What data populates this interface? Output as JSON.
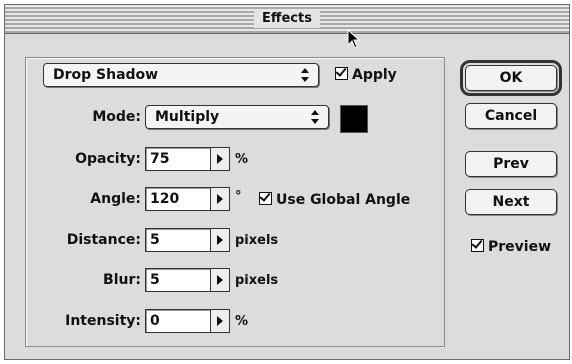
{
  "window": {
    "title": "Effects"
  },
  "effect_select": {
    "value": "Drop Shadow"
  },
  "apply": {
    "label": "Apply",
    "checked": true
  },
  "mode": {
    "label": "Mode:",
    "value": "Multiply"
  },
  "shadow_color": {
    "color": "#000000"
  },
  "opacity": {
    "label": "Opacity:",
    "value": "75",
    "unit": "%"
  },
  "angle": {
    "label": "Angle:",
    "value": "120",
    "unit": "°"
  },
  "global_angle": {
    "label": "Use Global Angle",
    "checked": true
  },
  "distance": {
    "label": "Distance:",
    "value": "5",
    "unit": "pixels"
  },
  "blur": {
    "label": "Blur:",
    "value": "5",
    "unit": "pixels"
  },
  "intensity": {
    "label": "Intensity:",
    "value": "0",
    "unit": "%"
  },
  "buttons": {
    "ok": "OK",
    "cancel": "Cancel",
    "prev": "Prev",
    "next": "Next"
  },
  "preview": {
    "label": "Preview",
    "checked": true
  }
}
